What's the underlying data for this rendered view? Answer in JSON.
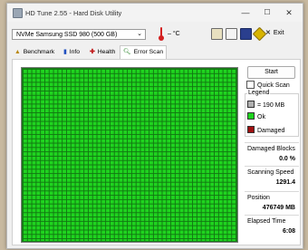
{
  "window": {
    "title": "HD Tune 2.55 - Hard Disk Utility",
    "minimize": "—",
    "maximize": "☐",
    "close": "✕"
  },
  "toolbar": {
    "drive": "NVMe    Samsung SSD 980 (500 GB)",
    "temperature": "– °C",
    "exit_label": "Exit"
  },
  "tabs": [
    {
      "label": "Benchmark",
      "icon": "benchmark-icon"
    },
    {
      "label": "Info",
      "icon": "info-icon"
    },
    {
      "label": "Health",
      "icon": "health-icon"
    },
    {
      "label": "Error Scan",
      "icon": "error-scan-icon",
      "active": true
    }
  ],
  "scan": {
    "start_label": "Start",
    "quick_scan_label": "Quick Scan",
    "quick_scan_checked": false
  },
  "legend": {
    "title": "Legend",
    "block_size": "= 190 MB",
    "ok": "Ok",
    "damaged": "Damaged",
    "colors": {
      "block": "#b0b0b0",
      "ok": "#1fd41f",
      "damaged": "#a01010"
    }
  },
  "stats": {
    "damaged_blocks": {
      "label": "Damaged Blocks",
      "value": "0.0 %"
    },
    "scanning_speed": {
      "label": "Scanning Speed",
      "value": "1291.4"
    },
    "position": {
      "label": "Position",
      "value": "476749 MB"
    },
    "elapsed_time": {
      "label": "Elapsed Time",
      "value": "6:08"
    }
  }
}
